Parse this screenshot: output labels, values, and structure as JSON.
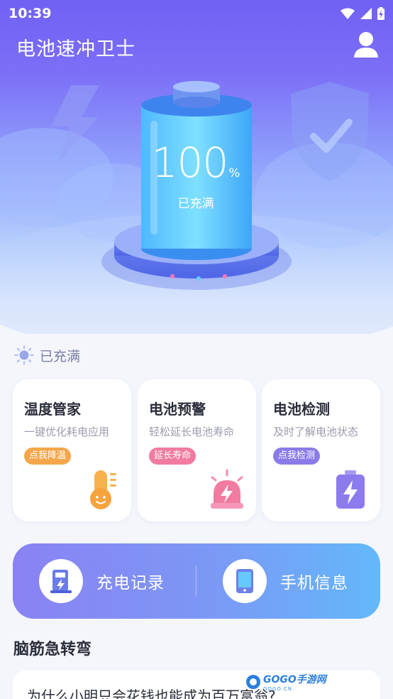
{
  "status_bar": {
    "time": "10:39"
  },
  "header": {
    "title": "电池速冲卫士"
  },
  "battery": {
    "percent": "100",
    "percent_sign": "%",
    "status": "已充满",
    "level": 1.0
  },
  "state_row": {
    "label": "已充满"
  },
  "cards": [
    {
      "title": "温度管家",
      "subtitle": "一键优化耗电应用",
      "tag": "点我降温",
      "tag_color": "#f5a64a",
      "icon": "thermometer-icon"
    },
    {
      "title": "电池预警",
      "subtitle": "轻松延长电池寿命",
      "tag": "延长寿命",
      "tag_color": "#f27ba0",
      "icon": "alarm-light-icon"
    },
    {
      "title": "电池检测",
      "subtitle": "及时了解电池状态",
      "tag": "点我检测",
      "tag_color": "#8a7ce8",
      "icon": "battery-charge-icon"
    }
  ],
  "actions": [
    {
      "label": "充电记录",
      "icon": "charging-station-icon"
    },
    {
      "label": "手机信息",
      "icon": "phone-icon"
    }
  ],
  "riddle": {
    "heading": "脑筋急转弯",
    "question": "为什么小明只会花钱也能成为百万富翁?"
  },
  "watermark": {
    "text": "GOGO手游网",
    "sub": "GOGO.CN"
  },
  "colors": {
    "accent": "#7161f4",
    "card_text": "#2a2d3a",
    "muted": "#9a9cac"
  }
}
